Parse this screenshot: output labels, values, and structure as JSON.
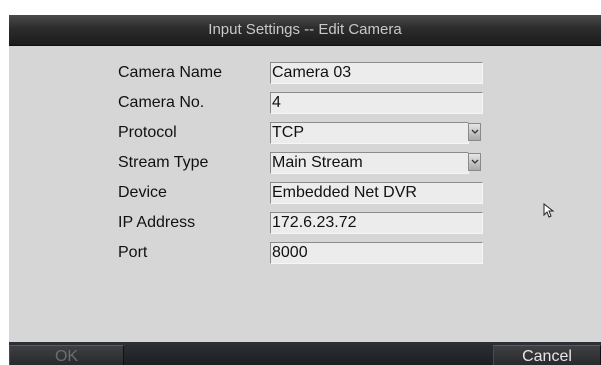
{
  "dialog": {
    "title": "Input Settings -- Edit Camera"
  },
  "fields": {
    "camera_name": {
      "label": "Camera Name",
      "value": "Camera 03"
    },
    "camera_no": {
      "label": "Camera No.",
      "value": "4"
    },
    "protocol": {
      "label": "Protocol",
      "value": "TCP"
    },
    "stream_type": {
      "label": "Stream Type",
      "value": "Main Stream"
    },
    "device": {
      "label": "Device",
      "value": "Embedded Net DVR"
    },
    "ip_address": {
      "label": "IP Address",
      "value": "172.6.23.72"
    },
    "port": {
      "label": "Port",
      "value": "8000"
    }
  },
  "buttons": {
    "ok": "OK",
    "cancel": "Cancel"
  },
  "icons": {
    "dropdown": "chevron-down-icon",
    "pointer": "mouse-cursor-icon"
  }
}
